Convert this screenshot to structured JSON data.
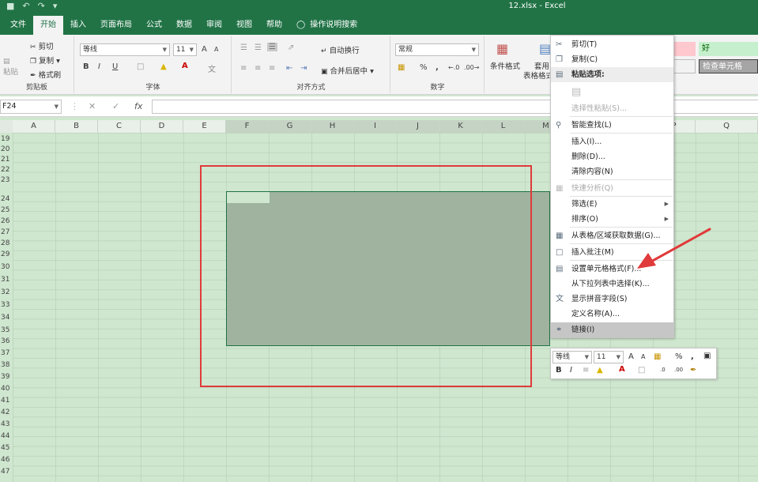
{
  "window": {
    "title": "12.xlsx  -  Excel"
  },
  "qat": {
    "save_icon": "save-icon",
    "undo": "↶",
    "redo": "↷",
    "more": "▾"
  },
  "tabs": [
    {
      "label": "文件"
    },
    {
      "label": "开始"
    },
    {
      "label": "插入"
    },
    {
      "label": "页面布局"
    },
    {
      "label": "公式"
    },
    {
      "label": "数据"
    },
    {
      "label": "审阅"
    },
    {
      "label": "视图"
    },
    {
      "label": "帮助"
    },
    {
      "label": "操作说明搜索"
    }
  ],
  "ribbon": {
    "clipboard": {
      "paste": "粘贴",
      "cut": "剪切",
      "copy": "复制",
      "format_painter": "格式刷",
      "label": "剪贴板"
    },
    "font": {
      "name": "等线",
      "size": "11",
      "label": "字体",
      "bold": "B",
      "italic": "I",
      "underline": "U",
      "grow": "A",
      "shrink": "A",
      "fontcolor": "A"
    },
    "alignment": {
      "wrap": "自动换行",
      "merge": "合并后居中",
      "label": "对齐方式"
    },
    "number": {
      "format": "常规",
      "percent": "%",
      "comma": ",",
      "label": "数字"
    },
    "styles": {
      "cond_format": "条件格式",
      "table_format_1": "套用",
      "table_format_2": "表格格式",
      "good": "好",
      "check_cell": "检查单元格"
    }
  },
  "formula_bar": {
    "name_box": "F24",
    "cancel": "✕",
    "enter": "✓",
    "fx": "fx",
    "value": ""
  },
  "columns": [
    "A",
    "B",
    "C",
    "D",
    "E",
    "F",
    "G",
    "H",
    "I",
    "J",
    "K",
    "L",
    "M",
    "N",
    "O",
    "P",
    "Q"
  ],
  "rows": [
    "19",
    "20",
    "21",
    "22",
    "23",
    "24",
    "25",
    "26",
    "27",
    "28",
    "29",
    "30",
    "31",
    "32",
    "33",
    "34",
    "35",
    "36",
    "37",
    "38",
    "39",
    "40",
    "41",
    "42",
    "43",
    "44",
    "45",
    "46",
    "47"
  ],
  "context_menu": {
    "cut": "剪切(T)",
    "copy": "复制(C)",
    "paste_options": "粘贴选项:",
    "paste_special": "选择性粘贴(S)...",
    "smart_lookup": "智能查找(L)",
    "insert": "插入(I)...",
    "delete": "删除(D)...",
    "clear": "清除内容(N)",
    "quick_analysis": "快速分析(Q)",
    "filter": "筛选(E)",
    "sort": "排序(O)",
    "from_table": "从表格/区域获取数据(G)...",
    "insert_comment": "插入批注(M)",
    "format_cells": "设置单元格格式(F)...",
    "pick_from_list": "从下拉列表中选择(K)...",
    "phonetic": "显示拼音字段(S)",
    "define_name": "定义名称(A)...",
    "link": "链接(I)"
  },
  "mini_toolbar": {
    "font": "等线",
    "size": "11",
    "percent": "%",
    "comma": ",",
    "bold": "B",
    "italic": "I"
  },
  "colors": {
    "excel_green": "#217346",
    "annotation_red": "#e03a3a",
    "grid_bg": "#cfe6cf"
  }
}
